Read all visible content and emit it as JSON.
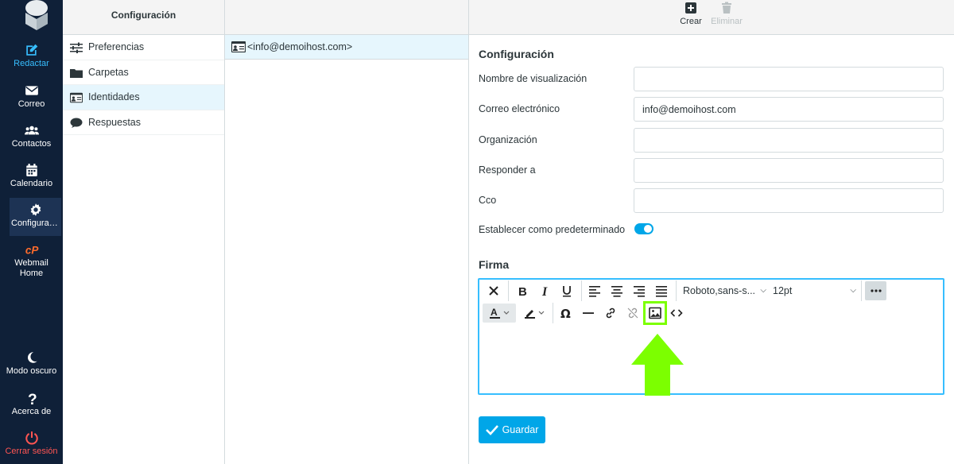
{
  "nav": {
    "items": [
      {
        "label": "Redactar",
        "icon": "compose-icon"
      },
      {
        "label": "Correo",
        "icon": "envelope-icon"
      },
      {
        "label": "Contactos",
        "icon": "users-icon"
      },
      {
        "label": "Calendario",
        "icon": "calendar-icon"
      },
      {
        "label": "Configuración",
        "icon": "gear-icon"
      },
      {
        "label": "Webmail Home",
        "icon": "cpanel-icon"
      },
      {
        "label": "Modo oscuro",
        "icon": "moon-icon"
      },
      {
        "label": "Acerca de",
        "icon": "question-icon"
      },
      {
        "label": "Cerrar sesión",
        "icon": "power-icon"
      }
    ]
  },
  "settings": {
    "title": "Configuración",
    "items": [
      {
        "label": "Preferencias",
        "icon": "sliders-icon"
      },
      {
        "label": "Carpetas",
        "icon": "folder-icon"
      },
      {
        "label": "Identidades",
        "icon": "id-card-icon"
      },
      {
        "label": "Respuestas",
        "icon": "speech-bubble-icon"
      }
    ]
  },
  "identities": {
    "items": [
      {
        "label": "<info@demoihost.com>",
        "icon": "id-card-icon"
      }
    ]
  },
  "toolbar": {
    "create_label": "Crear",
    "delete_label": "Eliminar"
  },
  "form": {
    "section_title": "Configuración",
    "fields": {
      "display_name": {
        "label": "Nombre de visualización",
        "value": ""
      },
      "email": {
        "label": "Correo electrónico",
        "value": "info@demoihost.com"
      },
      "organization": {
        "label": "Organización",
        "value": ""
      },
      "reply_to": {
        "label": "Responder a",
        "value": ""
      },
      "bcc": {
        "label": "Cco",
        "value": ""
      }
    },
    "default_label": "Establecer como predeterminado",
    "default_on": true,
    "signature_title": "Firma",
    "editor": {
      "font_family": "Roboto,sans-s...",
      "font_size": "12pt"
    },
    "save_label": "Guardar"
  },
  "colors": {
    "nav_bg": "#0f2038",
    "accent": "#00a6e8",
    "highlight": "#7cff00",
    "logout": "#ff5552"
  }
}
